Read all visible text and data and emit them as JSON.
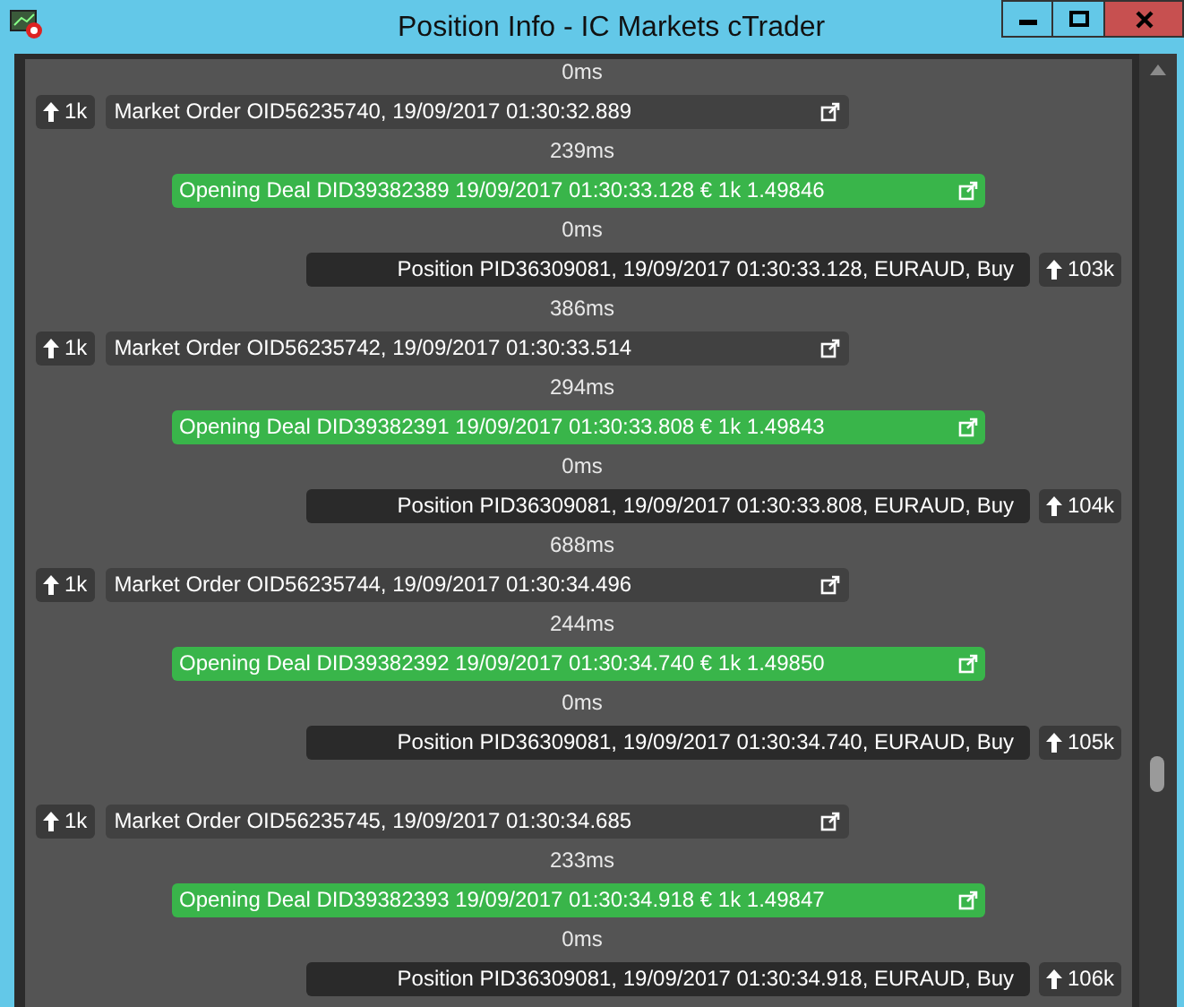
{
  "window": {
    "title": "Position Info - IC Markets cTrader"
  },
  "timeline": [
    {
      "kind": "latency",
      "text": "0ms"
    },
    {
      "kind": "order",
      "volume": "1k",
      "text": "Market Order OID56235740, 19/09/2017 01:30:32.889"
    },
    {
      "kind": "latency",
      "text": "239ms"
    },
    {
      "kind": "deal",
      "text": "Opening Deal DID39382389 19/09/2017 01:30:33.128 € 1k 1.49846"
    },
    {
      "kind": "latency",
      "text": "0ms"
    },
    {
      "kind": "position",
      "volume": "103k",
      "text": "Position PID36309081, 19/09/2017 01:30:33.128, EURAUD, Buy"
    },
    {
      "kind": "latency",
      "text": "386ms"
    },
    {
      "kind": "order",
      "volume": "1k",
      "text": "Market Order OID56235742, 19/09/2017 01:30:33.514"
    },
    {
      "kind": "latency",
      "text": "294ms"
    },
    {
      "kind": "deal",
      "text": "Opening Deal DID39382391 19/09/2017 01:30:33.808 € 1k 1.49843"
    },
    {
      "kind": "latency",
      "text": "0ms"
    },
    {
      "kind": "position",
      "volume": "104k",
      "text": "Position PID36309081, 19/09/2017 01:30:33.808, EURAUD, Buy"
    },
    {
      "kind": "latency",
      "text": "688ms"
    },
    {
      "kind": "order",
      "volume": "1k",
      "text": "Market Order OID56235744, 19/09/2017 01:30:34.496"
    },
    {
      "kind": "latency",
      "text": "244ms"
    },
    {
      "kind": "deal",
      "text": "Opening Deal DID39382392 19/09/2017 01:30:34.740 € 1k 1.49850"
    },
    {
      "kind": "latency",
      "text": "0ms"
    },
    {
      "kind": "position",
      "volume": "105k",
      "text": "Position PID36309081, 19/09/2017 01:30:34.740, EURAUD, Buy"
    },
    {
      "kind": "spacer"
    },
    {
      "kind": "order",
      "volume": "1k",
      "text": "Market Order OID56235745, 19/09/2017 01:30:34.685"
    },
    {
      "kind": "latency",
      "text": "233ms"
    },
    {
      "kind": "deal",
      "text": "Opening Deal DID39382393 19/09/2017 01:30:34.918 € 1k 1.49847"
    },
    {
      "kind": "latency",
      "text": "0ms"
    },
    {
      "kind": "position",
      "volume": "106k",
      "text": "Position PID36309081, 19/09/2017 01:30:34.918, EURAUD, Buy"
    }
  ]
}
